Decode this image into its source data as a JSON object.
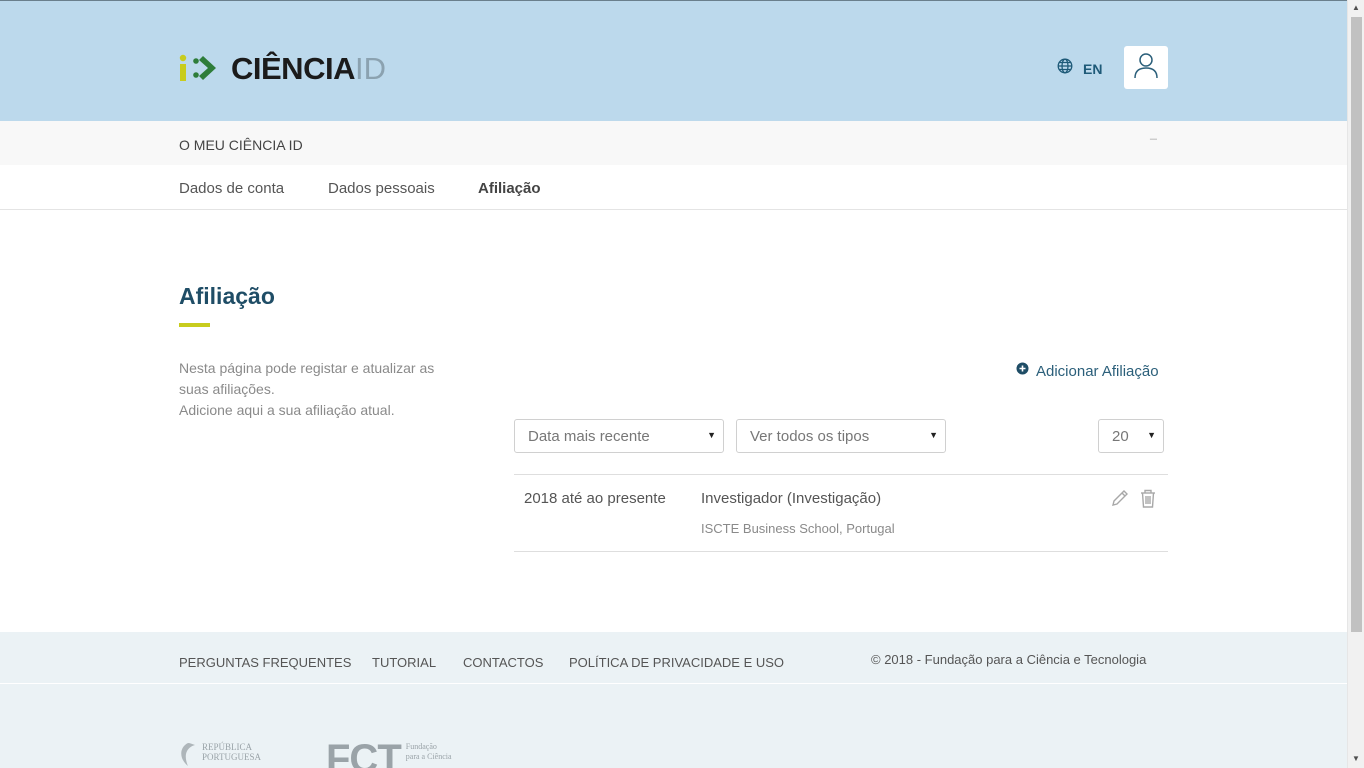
{
  "header": {
    "logo_text": "CIÊNCIA",
    "logo_suffix": "ID",
    "language": "EN",
    "colors": {
      "background": "#bcd9ec",
      "accent_yellow": "#c8cc1d",
      "accent_green": "#2e7d3a",
      "title_blue": "#1f4d66"
    }
  },
  "subnav": {
    "title": "O MEU CIÊNCIA ID"
  },
  "tabs": [
    {
      "label": "Dados de conta",
      "active": false
    },
    {
      "label": "Dados pessoais",
      "active": false
    },
    {
      "label": "Afiliação",
      "active": true
    }
  ],
  "main": {
    "title": "Afiliação",
    "intro_lines": [
      "Nesta página pode registar e atualizar as",
      "suas afiliações.",
      "Adicione aqui a sua afiliação atual."
    ],
    "add_label": "Adicionar Afiliação",
    "filters": {
      "sort_value": "Data mais recente",
      "type_value": "Ver todos os tipos",
      "page_size": "20"
    },
    "affiliations": [
      {
        "period": "2018 até ao presente",
        "role": "Investigador (Investigação)",
        "organization": "ISCTE Business School, Portugal",
        "actions": [
          "pencil-icon",
          "trash-icon"
        ]
      }
    ]
  },
  "footer": {
    "links": [
      "PERGUNTAS FREQUENTES",
      "TUTORIAL",
      "CONTACTOS",
      "POLÍTICA DE PRIVACIDADE E USO"
    ],
    "copyright": "© 2018 - Fundação para a Ciência e Tecnologia",
    "logos": {
      "republica": [
        "REPÚBLICA",
        "PORTUGUESA"
      ],
      "fct_letters": "FCT",
      "fct_text": [
        "Fundação",
        "para a Ciência"
      ]
    }
  }
}
